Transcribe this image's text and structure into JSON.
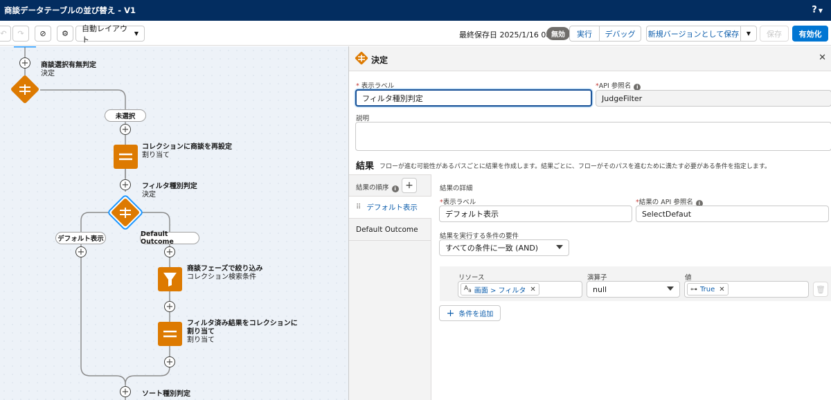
{
  "window": {
    "title": "商談データテーブルの並び替え - V1",
    "help": "?"
  },
  "toolbar": {
    "undo_icon": "undo-icon",
    "redo_icon": "redo-icon",
    "cancel_icon": "no-entry-icon",
    "settings_icon": "gear-icon",
    "layout_select": "自動レイアウト",
    "last_saved": "最終保存日 2025/1/16 08:55",
    "status_badge": "無効",
    "run_label": "実行",
    "debug_label": "デバッグ",
    "save_new_version_label": "新規バージョンとして保存",
    "save_label": "保存",
    "activate_label": "有効化"
  },
  "canvas": {
    "nodes": [
      {
        "name": "商談選択有無判定",
        "type": "決定"
      },
      {
        "name": "コレクションに商談を再設定",
        "type": "割り当て"
      },
      {
        "name": "フィルタ種別判定",
        "type": "決定"
      },
      {
        "name": "商談フェーズで絞り込み",
        "type": "コレクション検索条件"
      },
      {
        "name": "フィルタ済み結果をコレクションに割り当て",
        "name_line1": "フィルタ済み結果をコレクションに",
        "name_line2": "割り当て",
        "type": "割り当て"
      },
      {
        "name": "ソート種別判定"
      }
    ],
    "branches": {
      "unselected": "未選択",
      "default_display": "デフォルト表示",
      "default_outcome": "Default Outcome"
    }
  },
  "panel": {
    "title": "決定",
    "label_field": {
      "label": "表示ラベル",
      "value": "フィルタ種別判定"
    },
    "api_field": {
      "label": "API 参照名",
      "value": "JudgeFilter"
    },
    "description": {
      "label": "説明",
      "value": ""
    },
    "outcomes_section": {
      "title": "結果",
      "description": "フローが進む可能性があるパスごとに結果を作成します。結果ごとに、フローがそのパスを進むために満たす必要がある条件を指定します。",
      "order_label": "結果の順序",
      "items": [
        "デフォルト表示",
        "Default Outcome"
      ],
      "selected": "デフォルト表示"
    },
    "outcome_detail": {
      "title": "結果の詳細",
      "label_field": {
        "label": "表示ラベル",
        "value": "デフォルト表示"
      },
      "api_field": {
        "label": "結果の API 参照名",
        "value": "SelectDefaut"
      },
      "condition_req_label": "結果を実行する条件の要件",
      "condition_req_value": "すべての条件に一致 (AND)",
      "condition": {
        "resource_label": "リソース",
        "resource_value": "画面 > フィルタ",
        "operator_label": "演算子",
        "operator_value": "null",
        "value_label": "値",
        "value_value": "True"
      },
      "add_condition_label": "条件を追加"
    }
  },
  "colors": {
    "navy": "#032d60",
    "brand": "#0176d3",
    "decision": "#dd7a01",
    "assignment": "#dd7a01"
  }
}
